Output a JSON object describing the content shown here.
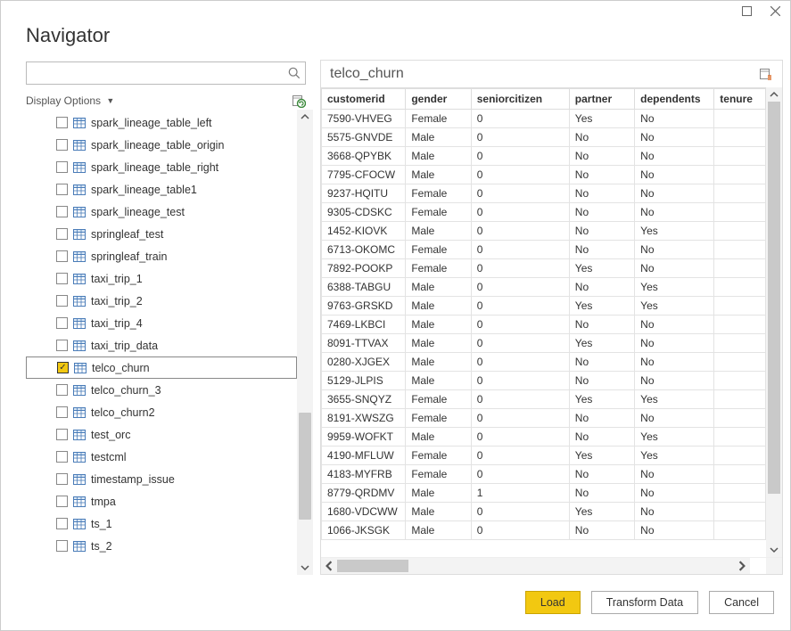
{
  "window": {
    "title": "Navigator"
  },
  "search": {
    "value": "",
    "placeholder": ""
  },
  "display_options_label": "Display Options",
  "tree_items": [
    {
      "label": "spark_lineage_table_left",
      "checked": false,
      "selected": false
    },
    {
      "label": "spark_lineage_table_origin",
      "checked": false,
      "selected": false
    },
    {
      "label": "spark_lineage_table_right",
      "checked": false,
      "selected": false
    },
    {
      "label": "spark_lineage_table1",
      "checked": false,
      "selected": false
    },
    {
      "label": "spark_lineage_test",
      "checked": false,
      "selected": false
    },
    {
      "label": "springleaf_test",
      "checked": false,
      "selected": false
    },
    {
      "label": "springleaf_train",
      "checked": false,
      "selected": false
    },
    {
      "label": "taxi_trip_1",
      "checked": false,
      "selected": false
    },
    {
      "label": "taxi_trip_2",
      "checked": false,
      "selected": false
    },
    {
      "label": "taxi_trip_4",
      "checked": false,
      "selected": false
    },
    {
      "label": "taxi_trip_data",
      "checked": false,
      "selected": false
    },
    {
      "label": "telco_churn",
      "checked": true,
      "selected": true
    },
    {
      "label": "telco_churn_3",
      "checked": false,
      "selected": false
    },
    {
      "label": "telco_churn2",
      "checked": false,
      "selected": false
    },
    {
      "label": "test_orc",
      "checked": false,
      "selected": false
    },
    {
      "label": "testcml",
      "checked": false,
      "selected": false
    },
    {
      "label": "timestamp_issue",
      "checked": false,
      "selected": false
    },
    {
      "label": "tmpa",
      "checked": false,
      "selected": false
    },
    {
      "label": "ts_1",
      "checked": false,
      "selected": false
    },
    {
      "label": "ts_2",
      "checked": false,
      "selected": false
    }
  ],
  "preview": {
    "title": "telco_churn",
    "columns": [
      "customerid",
      "gender",
      "seniorcitizen",
      "partner",
      "dependents",
      "tenure"
    ],
    "rows": [
      {
        "customerid": "7590-VHVEG",
        "gender": "Female",
        "seniorcitizen": "0",
        "partner": "Yes",
        "dependents": "No",
        "tenure": ""
      },
      {
        "customerid": "5575-GNVDE",
        "gender": "Male",
        "seniorcitizen": "0",
        "partner": "No",
        "dependents": "No",
        "tenure": ""
      },
      {
        "customerid": "3668-QPYBK",
        "gender": "Male",
        "seniorcitizen": "0",
        "partner": "No",
        "dependents": "No",
        "tenure": ""
      },
      {
        "customerid": "7795-CFOCW",
        "gender": "Male",
        "seniorcitizen": "0",
        "partner": "No",
        "dependents": "No",
        "tenure": ""
      },
      {
        "customerid": "9237-HQITU",
        "gender": "Female",
        "seniorcitizen": "0",
        "partner": "No",
        "dependents": "No",
        "tenure": ""
      },
      {
        "customerid": "9305-CDSKC",
        "gender": "Female",
        "seniorcitizen": "0",
        "partner": "No",
        "dependents": "No",
        "tenure": ""
      },
      {
        "customerid": "1452-KIOVK",
        "gender": "Male",
        "seniorcitizen": "0",
        "partner": "No",
        "dependents": "Yes",
        "tenure": ""
      },
      {
        "customerid": "6713-OKOMC",
        "gender": "Female",
        "seniorcitizen": "0",
        "partner": "No",
        "dependents": "No",
        "tenure": ""
      },
      {
        "customerid": "7892-POOKP",
        "gender": "Female",
        "seniorcitizen": "0",
        "partner": "Yes",
        "dependents": "No",
        "tenure": ""
      },
      {
        "customerid": "6388-TABGU",
        "gender": "Male",
        "seniorcitizen": "0",
        "partner": "No",
        "dependents": "Yes",
        "tenure": ""
      },
      {
        "customerid": "9763-GRSKD",
        "gender": "Male",
        "seniorcitizen": "0",
        "partner": "Yes",
        "dependents": "Yes",
        "tenure": ""
      },
      {
        "customerid": "7469-LKBCI",
        "gender": "Male",
        "seniorcitizen": "0",
        "partner": "No",
        "dependents": "No",
        "tenure": ""
      },
      {
        "customerid": "8091-TTVAX",
        "gender": "Male",
        "seniorcitizen": "0",
        "partner": "Yes",
        "dependents": "No",
        "tenure": ""
      },
      {
        "customerid": "0280-XJGEX",
        "gender": "Male",
        "seniorcitizen": "0",
        "partner": "No",
        "dependents": "No",
        "tenure": ""
      },
      {
        "customerid": "5129-JLPIS",
        "gender": "Male",
        "seniorcitizen": "0",
        "partner": "No",
        "dependents": "No",
        "tenure": ""
      },
      {
        "customerid": "3655-SNQYZ",
        "gender": "Female",
        "seniorcitizen": "0",
        "partner": "Yes",
        "dependents": "Yes",
        "tenure": ""
      },
      {
        "customerid": "8191-XWSZG",
        "gender": "Female",
        "seniorcitizen": "0",
        "partner": "No",
        "dependents": "No",
        "tenure": ""
      },
      {
        "customerid": "9959-WOFKT",
        "gender": "Male",
        "seniorcitizen": "0",
        "partner": "No",
        "dependents": "Yes",
        "tenure": ""
      },
      {
        "customerid": "4190-MFLUW",
        "gender": "Female",
        "seniorcitizen": "0",
        "partner": "Yes",
        "dependents": "Yes",
        "tenure": ""
      },
      {
        "customerid": "4183-MYFRB",
        "gender": "Female",
        "seniorcitizen": "0",
        "partner": "No",
        "dependents": "No",
        "tenure": ""
      },
      {
        "customerid": "8779-QRDMV",
        "gender": "Male",
        "seniorcitizen": "1",
        "partner": "No",
        "dependents": "No",
        "tenure": ""
      },
      {
        "customerid": "1680-VDCWW",
        "gender": "Male",
        "seniorcitizen": "0",
        "partner": "Yes",
        "dependents": "No",
        "tenure": ""
      },
      {
        "customerid": "1066-JKSGK",
        "gender": "Male",
        "seniorcitizen": "0",
        "partner": "No",
        "dependents": "No",
        "tenure": ""
      }
    ]
  },
  "footer": {
    "load": "Load",
    "transform": "Transform Data",
    "cancel": "Cancel"
  }
}
